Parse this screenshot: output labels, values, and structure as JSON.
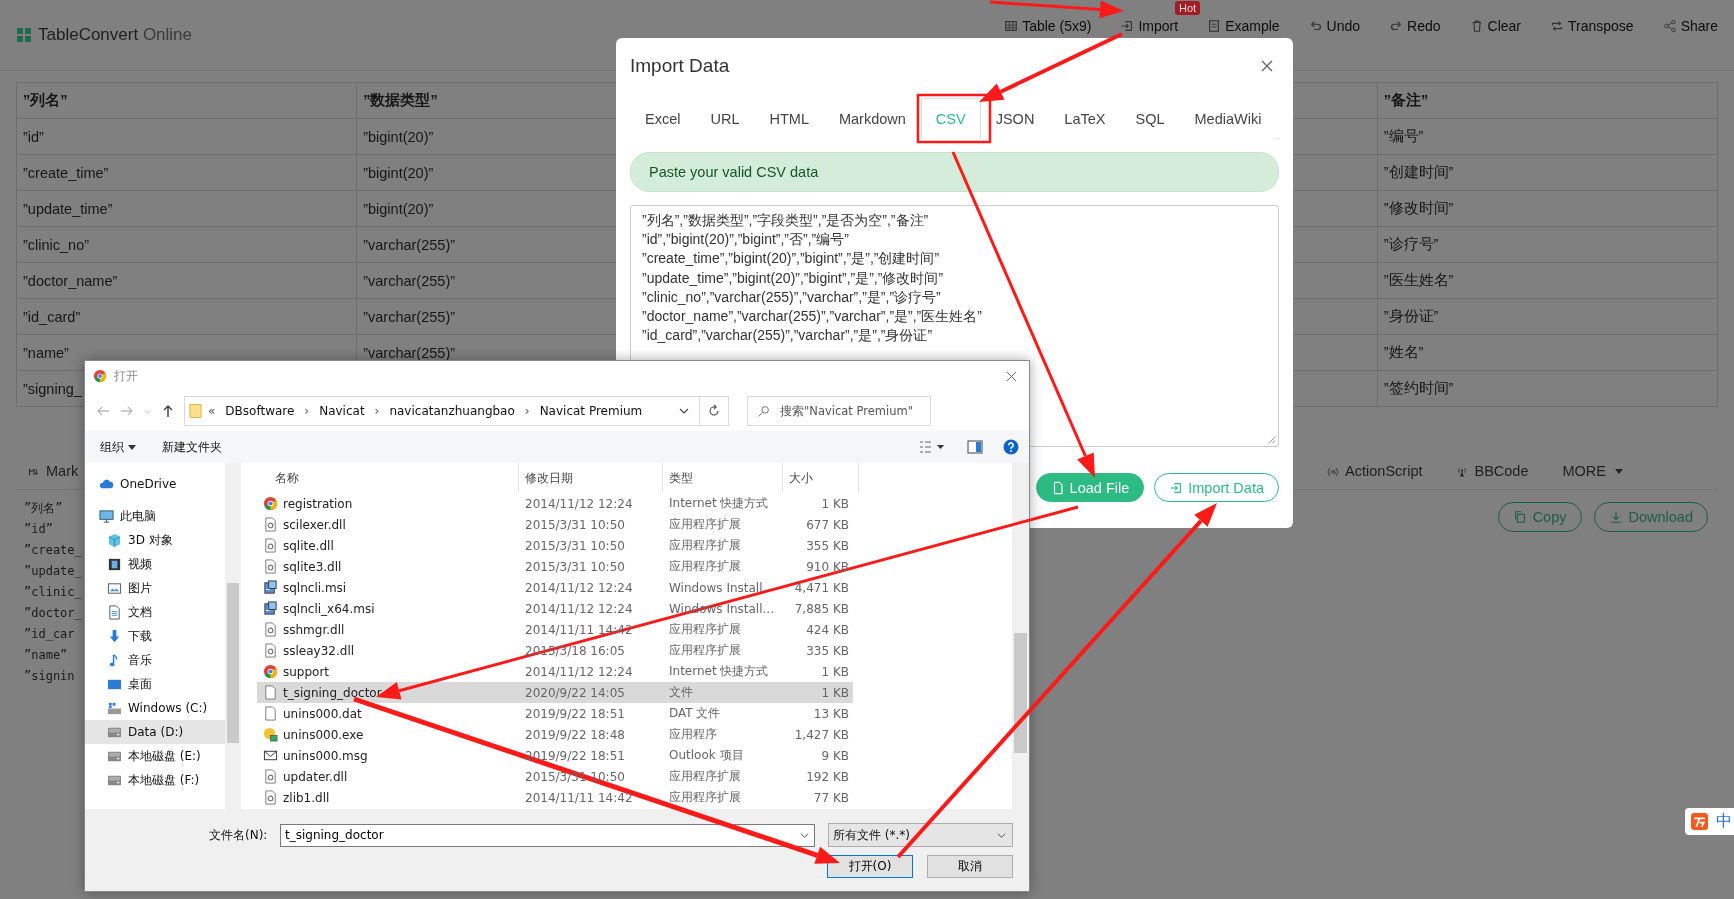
{
  "app": {
    "name": "TableConvert",
    "suffix": "Online"
  },
  "toolbar": [
    {
      "label": "Table (5x9)",
      "kind": "table"
    },
    {
      "label": "Import",
      "kind": "import",
      "badge": "Hot"
    },
    {
      "label": "Example",
      "kind": "example"
    },
    {
      "label": "Undo",
      "kind": "undo"
    },
    {
      "label": "Redo",
      "kind": "redo"
    },
    {
      "label": "Clear",
      "kind": "clear"
    },
    {
      "label": "Transpose",
      "kind": "transpose"
    },
    {
      "label": "Share",
      "kind": "share"
    }
  ],
  "table": {
    "columns": [
      {
        "header": "”列名”",
        "cells": [
          "”id”",
          "”create_time”",
          "”update_time”",
          "”clinic_no”",
          "”doctor_name”",
          "”id_card”",
          "”name”",
          "”signing_"
        ]
      },
      {
        "header": "”数据类型”",
        "cells": [
          "”bigint(20)”",
          "”bigint(20)”",
          "”bigint(20)”",
          "”varchar(255)”",
          "”varchar(255)”",
          "”varchar(255)”",
          "”varchar(255)”"
        ]
      },
      {
        "header": "”备注”",
        "cells": [
          "”编号”",
          "”创建时间”",
          "”修改时间”",
          "”诊疗号”",
          "”医生姓名”",
          "”身份证”",
          "”姓名”",
          "”签约时间”"
        ]
      }
    ]
  },
  "format_tabs": [
    {
      "label": "Mark",
      "kind": "markdown"
    },
    {
      "label": "ActionScript",
      "kind": "actionscript"
    },
    {
      "label": "BBCode",
      "kind": "bbcode"
    },
    {
      "label": "MORE",
      "kind": "more"
    }
  ],
  "output_lines": [
    "”列名”",
    "”id”",
    "”create_",
    "”update_",
    "”clinic_",
    "”doctor_",
    "”id_car",
    "”name”",
    "”signin"
  ],
  "output_buttons": [
    {
      "label": "Copy",
      "kind": "copy"
    },
    {
      "label": "Download",
      "kind": "download"
    }
  ],
  "modal": {
    "title": "Import Data",
    "tabs": [
      {
        "label": "Excel",
        "selected": false
      },
      {
        "label": "URL",
        "selected": false
      },
      {
        "label": "HTML",
        "selected": false
      },
      {
        "label": "Markdown",
        "selected": false
      },
      {
        "label": "CSV",
        "selected": true
      },
      {
        "label": "JSON",
        "selected": false
      },
      {
        "label": "LaTeX",
        "selected": false
      },
      {
        "label": "SQL",
        "selected": false
      },
      {
        "label": "MediaWiki",
        "selected": false
      }
    ],
    "alert": "Paste your valid CSV data",
    "lines": [
      "”列名”,”数据类型”,”字段类型”,”是否为空”,”备注”",
      "”id”,”bigint(20)”,”bigint”,”否”,”编号”",
      "”create_time”,”bigint(20)”,”bigint”,”是”,”创建时间”",
      "”update_time”,”bigint(20)”,”bigint”,”是”,”修改时间”",
      "”clinic_no”,”varchar(255)”,”varchar”,”是”,”诊疗号”",
      "”doctor_name”,”varchar(255)”,”varchar”,”是”,”医生姓名”",
      "”id_card”,”varchar(255)”,”varchar”,”是”,”身份证”"
    ],
    "buttons": [
      {
        "label": "Load File",
        "kind": "primary"
      },
      {
        "label": "Import Data",
        "kind": "outline"
      }
    ]
  },
  "file_dialog": {
    "title": "打开",
    "path_prefix": "«",
    "path_separator": "›",
    "path": [
      "DBsoftware",
      "Navicat",
      "navicatanzhuangbao",
      "Navicat Premium"
    ],
    "search_placeholder": "搜索\"Navicat Premium\"",
    "commands": [
      "组织",
      "新建文件夹"
    ],
    "sidebar": [
      {
        "label": "OneDrive",
        "kind": "cloud",
        "selected": false
      },
      {
        "label": "此电脑",
        "kind": "pc",
        "selected": false,
        "children": [
          {
            "label": "3D 对象",
            "kind": "cube",
            "selected": false
          },
          {
            "label": "视频",
            "kind": "video",
            "selected": false
          },
          {
            "label": "图片",
            "kind": "picture",
            "selected": false
          },
          {
            "label": "文档",
            "kind": "document",
            "selected": false
          },
          {
            "label": "下载",
            "kind": "download",
            "selected": false
          },
          {
            "label": "音乐",
            "kind": "music",
            "selected": false
          },
          {
            "label": "桌面",
            "kind": "desktop",
            "selected": false
          },
          {
            "label": "Windows (C:)",
            "kind": "system",
            "selected": false
          },
          {
            "label": "Data (D:)",
            "kind": "drive",
            "selected": true
          },
          {
            "label": "本地磁盘 (E:)",
            "kind": "drive",
            "selected": false
          },
          {
            "label": "本地磁盘 (F:)",
            "kind": "drive",
            "selected": false
          }
        ]
      }
    ],
    "columns": [
      "名称",
      "修改日期",
      "类型",
      "大小"
    ],
    "files": [
      {
        "name": "registration",
        "date": "2014/11/12 12:24",
        "type": "Internet 快捷方式",
        "size": "1 KB",
        "kind": "shortcut",
        "selected": false
      },
      {
        "name": "scilexer.dll",
        "date": "2015/3/31 10:50",
        "type": "应用程序扩展",
        "size": "677 KB",
        "kind": "dll",
        "selected": false
      },
      {
        "name": "sqlite.dll",
        "date": "2015/3/31 10:50",
        "type": "应用程序扩展",
        "size": "355 KB",
        "kind": "dll",
        "selected": false
      },
      {
        "name": "sqlite3.dll",
        "date": "2015/3/31 10:50",
        "type": "应用程序扩展",
        "size": "910 KB",
        "kind": "dll",
        "selected": false
      },
      {
        "name": "sqlncli.msi",
        "date": "2014/11/12 12:24",
        "type": "Windows Install",
        "size": "4,471 KB",
        "kind": "msi",
        "selected": false
      },
      {
        "name": "sqlncli_x64.msi",
        "date": "2014/11/12 12:24",
        "type": "Windows Install...",
        "size": "7,885 KB",
        "kind": "msi",
        "selected": false
      },
      {
        "name": "sshmgr.dll",
        "date": "2014/11/11 14:42",
        "type": "应用程序扩展",
        "size": "424 KB",
        "kind": "dll",
        "selected": false
      },
      {
        "name": "ssleay32.dll",
        "date": "2015/3/18 16:05",
        "type": "应用程序扩展",
        "size": "335 KB",
        "kind": "dll",
        "selected": false
      },
      {
        "name": "support",
        "date": "2014/11/12 12:24",
        "type": "Internet 快捷方式",
        "size": "1 KB",
        "kind": "shortcut",
        "selected": false
      },
      {
        "name": "t_signing_doctor",
        "date": "2020/9/22 14:05",
        "type": "文件",
        "size": "1 KB",
        "kind": "file",
        "selected": true
      },
      {
        "name": "unins000.dat",
        "date": "2019/9/22 18:51",
        "type": "DAT 文件",
        "size": "13 KB",
        "kind": "file",
        "selected": false
      },
      {
        "name": "unins000.exe",
        "date": "2019/9/22 18:48",
        "type": "应用程序",
        "size": "1,427 KB",
        "kind": "exe",
        "selected": false
      },
      {
        "name": "unins000.msg",
        "date": "2019/9/22 18:51",
        "type": "Outlook 项目",
        "size": "9 KB",
        "kind": "mail",
        "selected": false
      },
      {
        "name": "updater.dll",
        "date": "2015/3/31 10:50",
        "type": "应用程序扩展",
        "size": "192 KB",
        "kind": "dll",
        "selected": false
      },
      {
        "name": "zlib1.dll",
        "date": "2014/11/11 14:42",
        "type": "应用程序扩展",
        "size": "77 KB",
        "kind": "dll",
        "selected": false
      }
    ],
    "filename_label": "文件名(N):",
    "filename": "t_signing_doctor",
    "filter": "所有文件 (*.*)",
    "buttons": [
      "打开(O)",
      "取消"
    ]
  },
  "ime": "中"
}
